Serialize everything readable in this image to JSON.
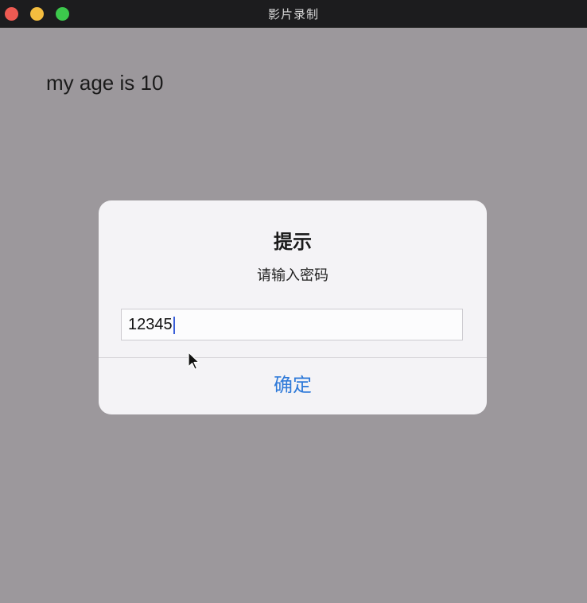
{
  "window": {
    "title": "影片录制"
  },
  "content": {
    "age_text": "my age is 10"
  },
  "alert": {
    "title": "提示",
    "message": "请输入密码",
    "input_value": "12345",
    "confirm_label": "确定"
  },
  "colors": {
    "background": "#9c989c",
    "alert_bg": "#f4f3f6",
    "confirm_text": "#2f7ad9",
    "traffic_close": "#ee5a52",
    "traffic_minimize": "#f4bd3f",
    "traffic_maximize": "#3cc84c"
  },
  "icons": {
    "pointer": "mouse-pointer-icon"
  }
}
